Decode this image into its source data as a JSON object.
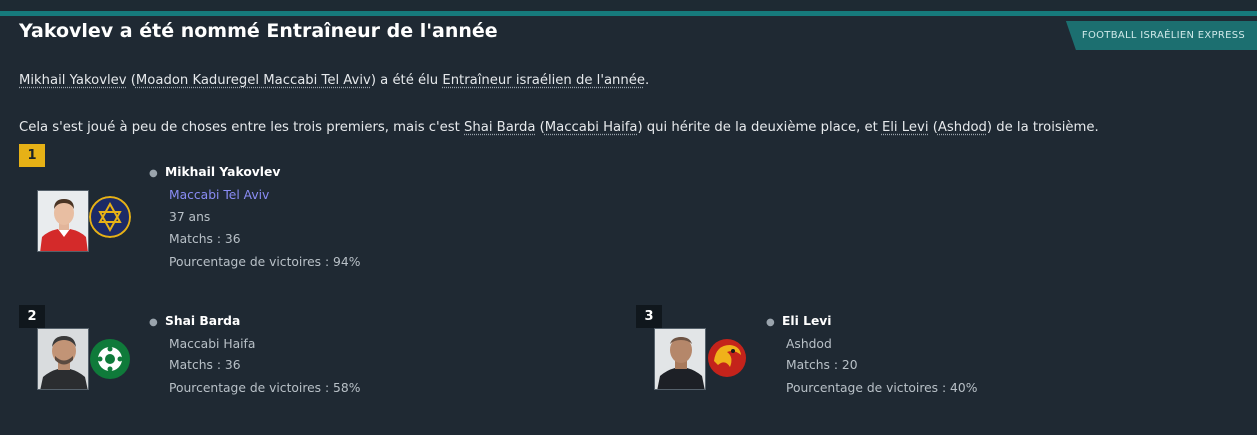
{
  "badge": "FOOTBALL ISRAÉLIEN EXPRESS",
  "headline": "Yakovlev a été nommé Entraîneur de l'année",
  "para1": {
    "coach": "Mikhail Yakovlev",
    "open_paren": " (",
    "club": "Moadon Kaduregel Maccabi Tel Aviv",
    "middle": ") a été élu ",
    "award": "Entraîneur israélien de l'année",
    "end": "."
  },
  "para2": {
    "intro": "Cela s'est joué à peu de choses entre les trois premiers, mais c'est ",
    "second_coach": "Shai Barda",
    "p1": " (",
    "second_club": "Maccabi Haifa",
    "p2": ") qui hérite de la deuxième place, et ",
    "third_coach": "Eli Levi",
    "p3": " (",
    "third_club": "Ashdod",
    "p4": ") de la troisième."
  },
  "nominees": [
    {
      "rank": "1",
      "name": "Mikhail Yakovlev",
      "club": "Maccabi Tel Aviv",
      "age": "37 ans",
      "matches": "Matchs : 36",
      "win_pct": "Pourcentage de victoires : 94%"
    },
    {
      "rank": "2",
      "name": "Shai Barda",
      "club": "Maccabi Haifa",
      "matches": "Matchs : 36",
      "win_pct": "Pourcentage de victoires : 58%"
    },
    {
      "rank": "3",
      "name": "Eli Levi",
      "club": "Ashdod",
      "matches": "Matchs : 20",
      "win_pct": "Pourcentage de victoires : 40%"
    }
  ],
  "colors": {
    "accent": "#167a7c",
    "gold": "#e6b116",
    "link": "#8a8cf5",
    "panel": "#1f2933"
  },
  "icons": {
    "person": "person-icon",
    "crest1": "maccabi-tel-aviv-crest-icon",
    "crest2": "maccabi-haifa-crest-icon",
    "crest3": "ashdod-crest-icon"
  }
}
